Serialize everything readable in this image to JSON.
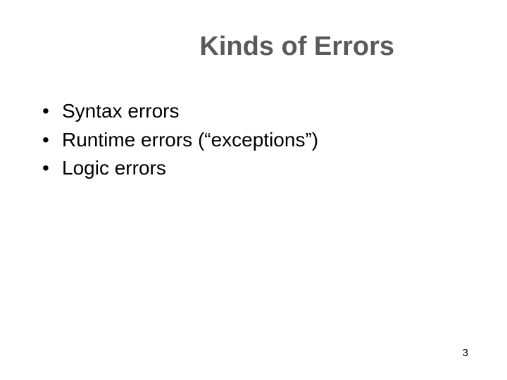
{
  "slide": {
    "title": "Kinds of Errors",
    "bullets": [
      "Syntax errors",
      "Runtime errors (“exceptions”)",
      "Logic errors"
    ],
    "page_number": "3"
  }
}
